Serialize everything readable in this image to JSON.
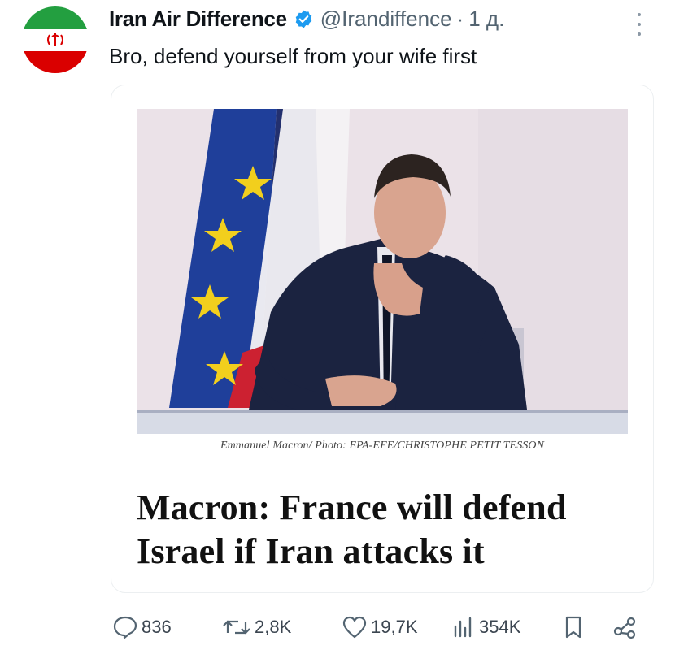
{
  "tweet": {
    "author": {
      "display_name": "Iran Air Difference",
      "handle": "@Irandiffence",
      "verified": true,
      "avatar_icon": "iran-flag-icon"
    },
    "separator": "·",
    "time": "1 д.",
    "text": "Bro, defend yourself from your wife first",
    "more_icon": "more-vertical-icon"
  },
  "card": {
    "image_description_icon": "news-photo",
    "caption": "Emmanuel Macron/ Photo: EPA-EFE/CHRISTOPHE PETIT TESSON",
    "headline_line1": "Macron: France will defend",
    "headline_line2": "Israel if Iran attacks it"
  },
  "actions": {
    "replies": "836",
    "reposts": "2,8K",
    "likes": "19,7K",
    "views": "354K"
  },
  "colors": {
    "text": "#0f1419",
    "muted": "#536471",
    "verified_blue": "#1d9bf0",
    "iran_green": "#239f40",
    "iran_red": "#da0000",
    "eu_blue": "#1f3f9a",
    "eu_star": "#f2cf1d",
    "france_blue": "#23306e"
  }
}
